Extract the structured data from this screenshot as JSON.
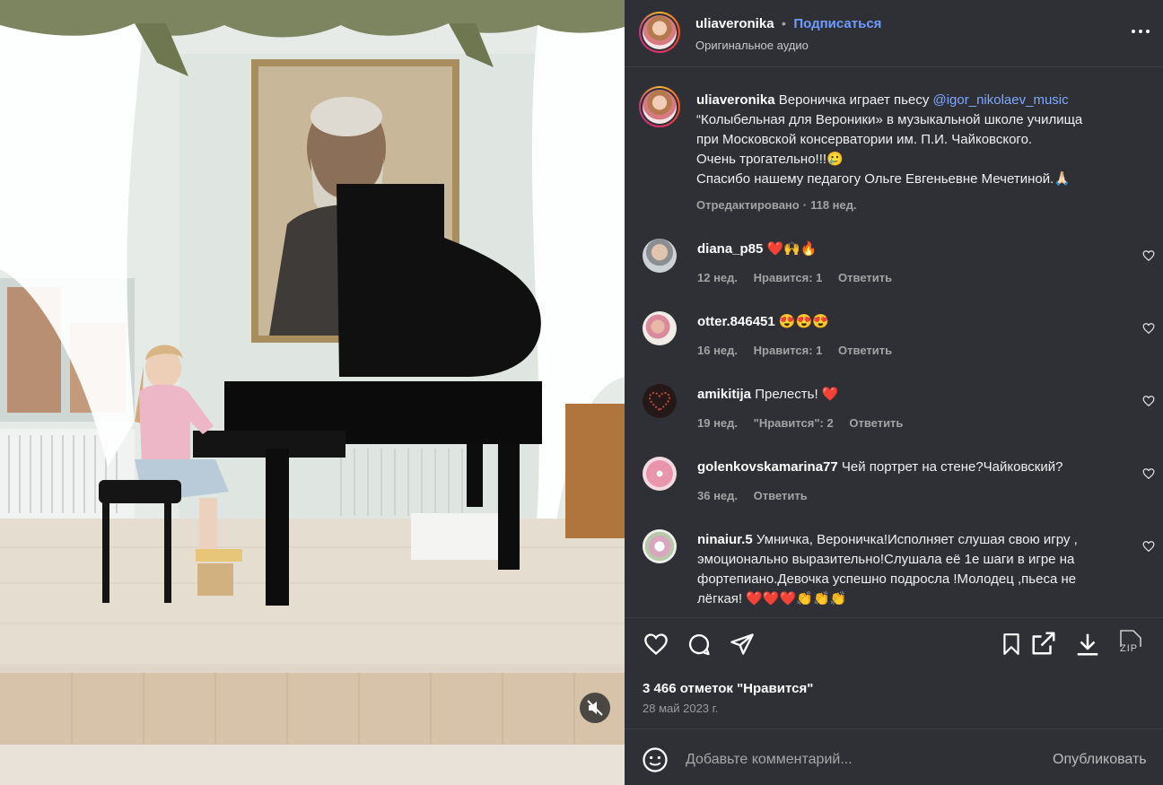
{
  "post": {
    "username": "uliaveronika",
    "separator": "•",
    "follow_label": "Подписаться",
    "audio": "Оригинальное аудио",
    "more_icon": "more-horizontal-icon"
  },
  "caption": {
    "username": "uliaveronika",
    "text_before": "Вероничка играет пьесу",
    "mention": "@igor_nikolaev_music",
    "line2": "“Колыбельная для Вероники» в музыкальной школе училища",
    "line3": "при Московской консерватории им. П.И. Чайковского.",
    "line4": "Очень трогательно!!!🥲",
    "line5": "Спасибо нашему педагогу Ольге Евгеньевне Мечетиной.🙏🏻",
    "edited": "Отредактировано",
    "time": "118 нед."
  },
  "comments": [
    {
      "user": "diana_p85",
      "text": "❤️🙌🔥",
      "time": "12 нед.",
      "likes": "Нравится: 1",
      "reply": "Ответить",
      "avatar_color": "#cdd2d6"
    },
    {
      "user": "otter.846451",
      "text": "😍😍😍",
      "time": "16 нед.",
      "likes": "Нравится: 1",
      "reply": "Ответить",
      "avatar_color": "#e8d7cf"
    },
    {
      "user": "amikitija",
      "text": "Прелесть! ❤️",
      "time": "19 нед.",
      "likes": "\"Нравится\": 2",
      "reply": "Ответить",
      "avatar_color": "#2a1a1a"
    },
    {
      "user": "golenkovskamarina77",
      "text": "Чей портрет на стене?Чайковский?",
      "time": "36 нед.",
      "likes": "",
      "reply": "Ответить",
      "avatar_color": "#e7a6b6"
    },
    {
      "user": "ninaiur.5",
      "text": "Умничка, Вероничка!Исполняет слушая свою игру ,",
      "line2": "эмоционально выразительно!Слушала её 1е шаги в игре на",
      "line3": "фортепиано.Девочка успешно подросла !Молодец ,пьеса не",
      "line4": "лёгкая! ❤️❤️❤️👏👏👏",
      "avatar_color": "#d6b6c6"
    }
  ],
  "actions": {
    "like_icon": "heart-icon",
    "comment_icon": "comment-icon",
    "share_icon": "send-icon",
    "save_icon": "bookmark-icon",
    "open_icon": "external-link-icon",
    "download_icon": "download-icon",
    "zip_label": "ZIP"
  },
  "likes_text": "3 466 отметок \"Нравится\"",
  "date": "28 май 2023 г.",
  "comment_box": {
    "placeholder": "Добавьте комментарий...",
    "publish": "Опубликовать"
  },
  "video": {
    "mute_icon": "muted-speaker-icon"
  },
  "colors": {
    "panel_bg": "#2e3036",
    "link_blue": "#6e9bff",
    "text": "#f0f0f0"
  }
}
